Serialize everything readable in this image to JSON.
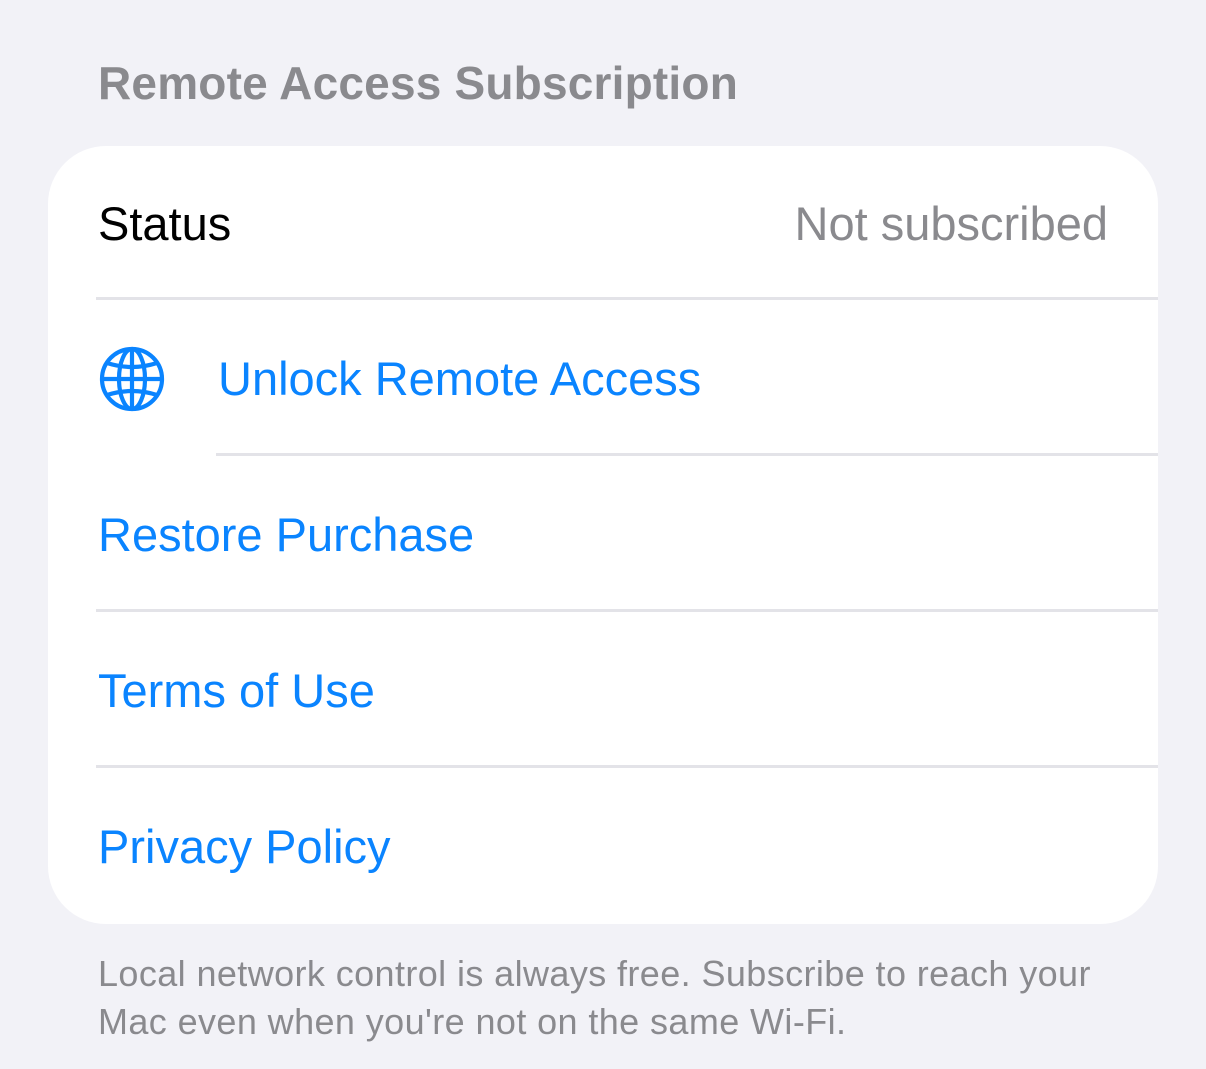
{
  "section": {
    "title": "Remote Access Subscription"
  },
  "status": {
    "label": "Status",
    "value": "Not subscribed"
  },
  "actions": {
    "unlock": {
      "label": "Unlock Remote Access",
      "icon": "globe-icon"
    },
    "restore": {
      "label": "Restore Purchase"
    },
    "terms": {
      "label": "Terms of Use"
    },
    "privacy": {
      "label": "Privacy Policy"
    }
  },
  "footer": {
    "text": "Local network control is always free. Subscribe to reach your Mac even when you're not on the same Wi-Fi."
  },
  "colors": {
    "accent": "#0a84ff",
    "secondary_text": "#8a8a8e",
    "background": "#f2f2f7",
    "card": "#ffffff"
  }
}
